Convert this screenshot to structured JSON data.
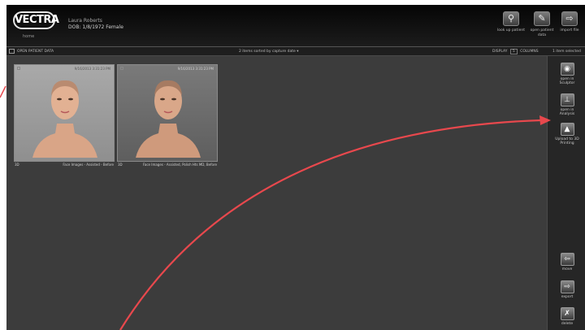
{
  "header": {
    "logo": "VECTRA",
    "home_label": "home",
    "patient_name": "Laura Roberts",
    "patient_info": "DOB: 1/8/1972   Female",
    "buttons": [
      {
        "label": "look up patient",
        "icon": "magnifier-icon"
      },
      {
        "label": "open patient data",
        "icon": "pen-icon"
      },
      {
        "label": "import file",
        "icon": "import-icon"
      }
    ]
  },
  "subbar": {
    "open_label": "OPEN PATIENT DATA",
    "sort_text": "2 items sorted by capture date",
    "display_label": "DISPLAY",
    "columns_value": "5",
    "columns_label": "COLUMNS",
    "selected_text": "1 item selected"
  },
  "images": [
    {
      "date": "9/16/2013 3:31:23 PM",
      "id": "3D",
      "caption": "Face Images - Assisted - Before"
    },
    {
      "date": "9/16/2013 3:31:23 PM",
      "id": "3D",
      "caption": "Face Images - Assisted, Polish Hts MD, Before"
    }
  ],
  "side_buttons": [
    {
      "label": "open in Sculptor",
      "icon": "eye-icon"
    },
    {
      "label": "open in Analysis",
      "icon": "analysis-icon"
    },
    {
      "label": "Upload to 3D Printing",
      "icon": "upload-icon"
    },
    {
      "label": "move",
      "icon": "move-icon"
    },
    {
      "label": "export",
      "icon": "export-icon"
    },
    {
      "label": "delete",
      "icon": "delete-icon"
    }
  ],
  "colors": {
    "annotation_arrow": "#e8484d",
    "panel_bg": "#3c3c3c",
    "header_bg": "#0a0a0a"
  }
}
